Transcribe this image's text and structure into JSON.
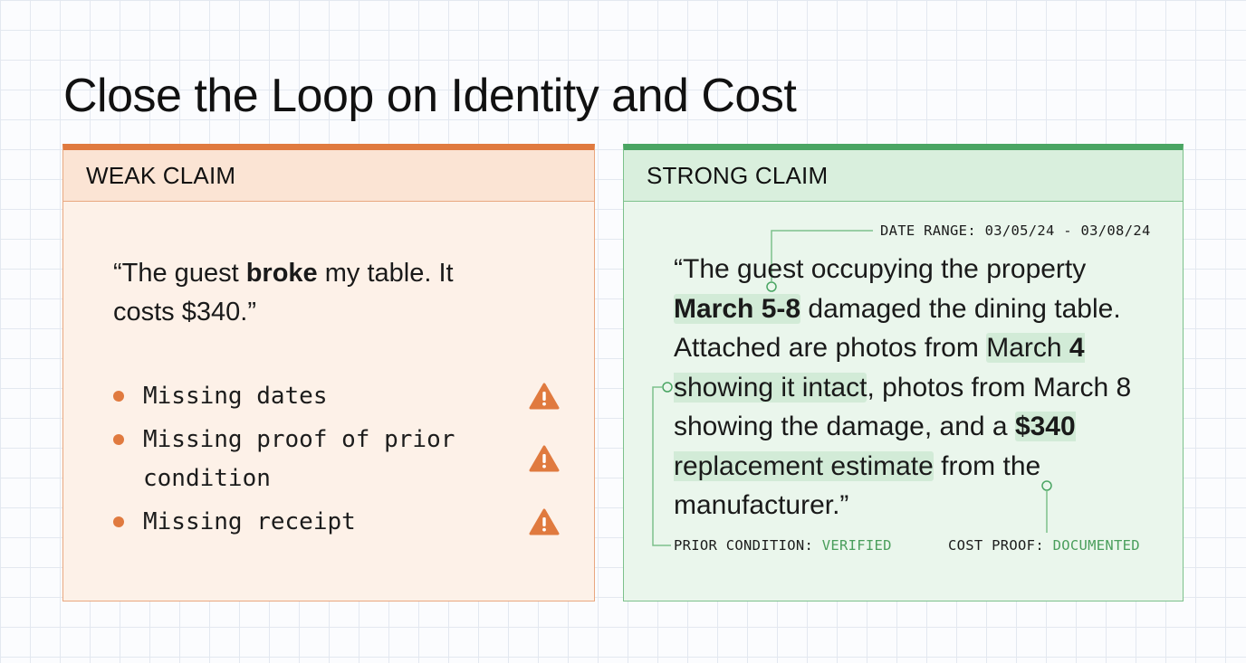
{
  "page": {
    "title": "Close the Loop on Identity and Cost"
  },
  "weak": {
    "header": "WEAK CLAIM",
    "quote": {
      "part1": "“The guest ",
      "bold": "broke",
      "part2": " my table. It costs $340.”"
    },
    "issues": [
      {
        "text": "Missing dates"
      },
      {
        "text": "Missing proof of prior condition"
      },
      {
        "text": "Missing receipt"
      }
    ],
    "accent_color": "#e07a3f"
  },
  "strong": {
    "header": "STRONG CLAIM",
    "quote": {
      "t1": "“The guest occupying the property ",
      "hl1": "March 5-8",
      "t2": " damaged the dining table. Attached are photos from ",
      "hl2a": "March ",
      "hl2b": "4",
      "hl2c": " showing it intact",
      "t3": ", photos from March 8 showing the damage, and a ",
      "hl3a": "$340",
      "hl3b": " replacement estimate",
      "t4": " from the manufacturer.”"
    },
    "annotations": {
      "date_range": "DATE RANGE: 03/05/24 - 03/08/24",
      "prior_label": "PRIOR CONDITION: ",
      "prior_value": "VERIFIED",
      "cost_label": "COST PROOF: ",
      "cost_value": "DOCUMENTED"
    },
    "accent_color": "#4aa563"
  }
}
